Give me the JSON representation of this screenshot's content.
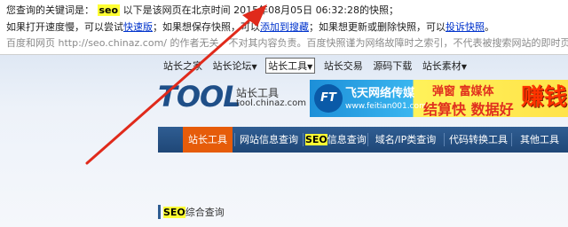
{
  "snapshot": {
    "line1_prefix": "您查询的关键词是：",
    "keyword": "seo",
    "line1_mid": "以下是该网页在北京时间",
    "snapshot_time": "2015年08月05日 06:32:28",
    "line1_suffix": "的快照；",
    "line2_a": "如果打开速度慢，可以尝试",
    "link_fast": "快速版",
    "line2_b": "；如果想保存快照，可以",
    "link_add": "添加到搜藏",
    "line2_c": "；如果想更新或删除快照，可以",
    "link_complain": "投诉快照",
    "line2_d": "。",
    "line3_a": "百度和网页",
    "line3_url": "http://seo.chinaz.com/",
    "line3_b": "的作者无关，不对其内容负责。百度快照谨为网络故障时之索引，不代表被搜索网站的即时页面。"
  },
  "topnav": {
    "items": [
      "站长之家",
      "站长论坛",
      "站长工具",
      "站长交易",
      "源码下载",
      "站长素材"
    ],
    "caret": "▼"
  },
  "logo": {
    "mark": "TOOL",
    "cn": "站长工具",
    "domain": "tool.chinaz.com"
  },
  "banner": {
    "logo_text": "FT",
    "name": "飞天网络传媒",
    "site": "www.feitian001.com",
    "slogan1": "弹窗 富媒体",
    "slogan2": "结算快 数据好",
    "earn": "赚钱"
  },
  "mainnav": {
    "items": [
      "站长工具",
      "网站信息查询",
      "信息查询",
      "域名/IP类查询",
      "代码转换工具",
      "其他工具"
    ],
    "seo_prefix": "SEO"
  },
  "section": {
    "seo": "SEO",
    "title": "综合查询"
  },
  "colors": {
    "accent": "#e65c0a",
    "nav_blue": "#1f4777",
    "highlight": "#ffff33",
    "arrow": "#e02a1b"
  }
}
